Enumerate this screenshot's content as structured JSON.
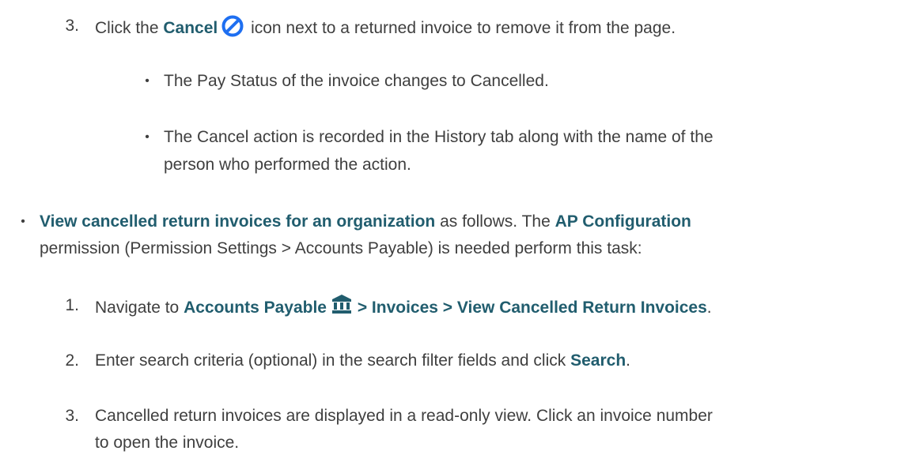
{
  "step3_cancel": {
    "number": "3.",
    "prefix": "Click the ",
    "cancel_label": "Cancel",
    "suffix": " icon next to a returned invoice to remove it from the page."
  },
  "sub_bullets": [
    {
      "marker": "•",
      "line1": "The Pay Status of the invoice changes to Cancelled."
    },
    {
      "marker": "•",
      "line1": "The Cancel action is recorded in the History tab along with the name of the",
      "line2": "person who performed the action."
    }
  ],
  "view_cancelled": {
    "marker": "•",
    "link_text": "View cancelled return invoices for an organization",
    "mid_text": " as follows. The ",
    "permission_name": "AP Configuration",
    "line2": "permission (Permission Settings > Accounts Payable) is needed perform this task:"
  },
  "steps": [
    {
      "number": "1.",
      "prefix": "Navigate to ",
      "nav_accounts_payable": "Accounts Payable",
      "nav_rest": " > Invoices > View Cancelled Return Invoices",
      "end": "."
    },
    {
      "number": "2.",
      "prefix": "Enter search criteria (optional) in the search filter fields and click ",
      "search_label": "Search",
      "end": "."
    },
    {
      "number": "3.",
      "line1": "Cancelled return invoices are displayed in a read-only view. Click an invoice number",
      "line2": "to open the invoice."
    }
  ],
  "icons": {
    "cancel": "cancel-circle-slash-icon",
    "accounts_payable": "bank-building-icon"
  },
  "colors": {
    "bold_text": "#215d6e",
    "body_text": "#3f3f3f",
    "cancel_icon": "#1e6ff1",
    "bank_icon": "#215d6e"
  }
}
